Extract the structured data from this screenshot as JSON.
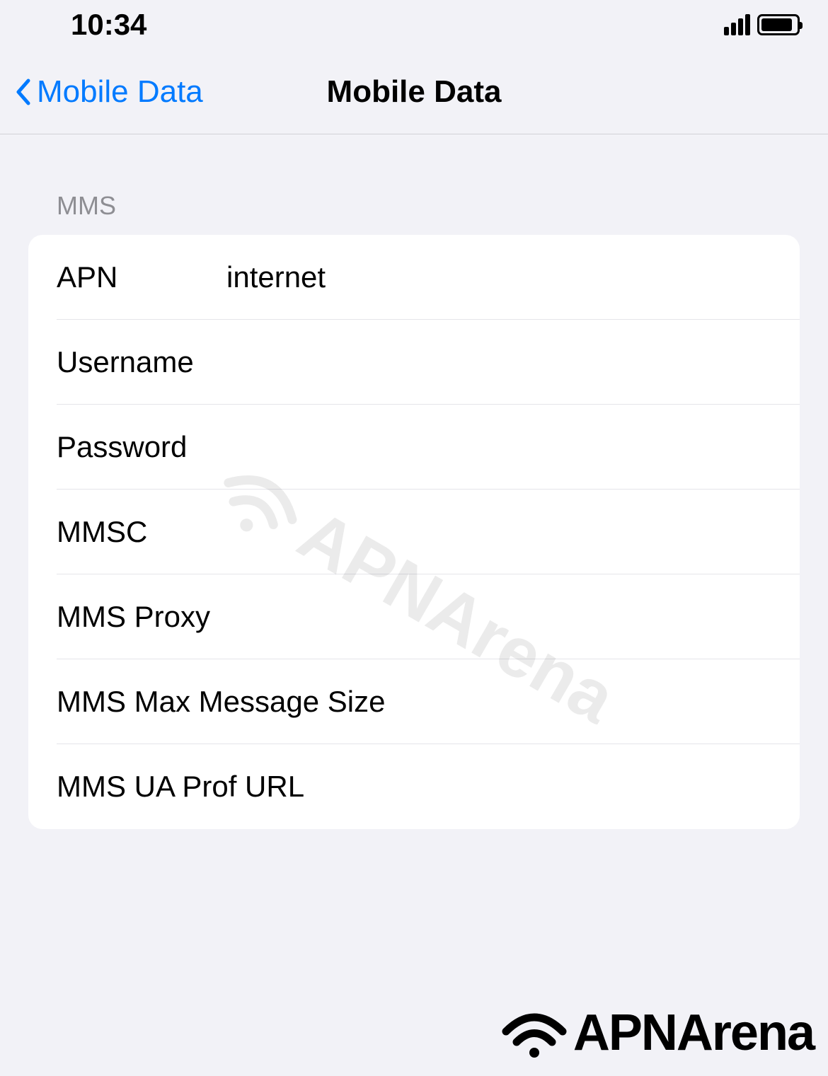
{
  "statusBar": {
    "time": "10:34"
  },
  "navBar": {
    "backLabel": "Mobile Data",
    "title": "Mobile Data"
  },
  "section": {
    "header": "MMS",
    "rows": [
      {
        "label": "APN",
        "value": "internet"
      },
      {
        "label": "Username",
        "value": ""
      },
      {
        "label": "Password",
        "value": ""
      },
      {
        "label": "MMSC",
        "value": ""
      },
      {
        "label": "MMS Proxy",
        "value": ""
      },
      {
        "label": "MMS Max Message Size",
        "value": ""
      },
      {
        "label": "MMS UA Prof URL",
        "value": ""
      }
    ]
  },
  "watermark": {
    "text": "APNArena"
  },
  "footer": {
    "text": "APNArena"
  }
}
